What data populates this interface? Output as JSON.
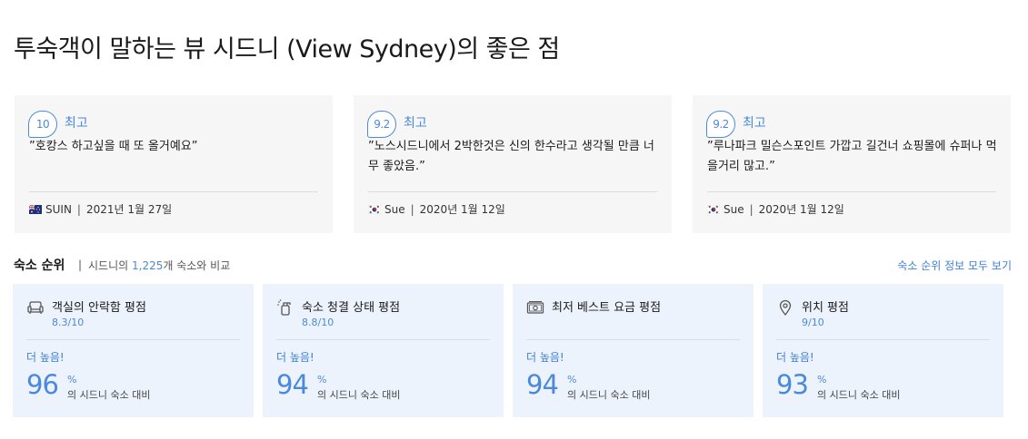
{
  "page": {
    "title": "투숙객이 말하는 뷰 시드니 (View Sydney)의 좋은 점"
  },
  "reviews": [
    {
      "score": "10",
      "score_word": "최고",
      "text": "”호캉스 하고싶을 때 또 올거예요”",
      "flag": "australia-flag-icon",
      "name": "SUIN",
      "date": "2021년 1월 27일"
    },
    {
      "score": "9.2",
      "score_word": "최고",
      "text": "”노스시드니에서 2박한것은 신의 한수라고 생각될 만큼 너무 좋았음.”",
      "flag": "south-korea-flag-icon",
      "name": "Sue",
      "date": "2020년 1월 12일"
    },
    {
      "score": "9.2",
      "score_word": "최고",
      "text": "”루나파크 밀슨스포인트 가깝고 길건너 쇼핑몰에 슈퍼나 먹을거리 많고.”",
      "flag": "south-korea-flag-icon",
      "name": "Sue",
      "date": "2020년 1월 12일"
    }
  ],
  "ranking": {
    "title": "숙소 순위",
    "separator": "|",
    "sub_prefix": "시드니의",
    "sub_count": "1,225",
    "sub_suffix": "개 숙소와 비교",
    "link": "숙소 순위 정보 모두 보기",
    "cards": [
      {
        "icon": "sofa-icon",
        "label": "객실의 안락함 평점",
        "score": "8.3/10",
        "higher": "더 높음!",
        "percent": "96",
        "percent_sign": "%",
        "compare": "의 시드니 숙소 대비"
      },
      {
        "icon": "cleaning-spray-icon",
        "label": "숙소 청결 상태 평점",
        "score": "8.8/10",
        "higher": "더 높음!",
        "percent": "94",
        "percent_sign": "%",
        "compare": "의 시드니 숙소 대비"
      },
      {
        "icon": "money-icon",
        "label": "최저 베스트 요금 평점",
        "score": "",
        "higher": "더 높음!",
        "percent": "94",
        "percent_sign": "%",
        "compare": "의 시드니 숙소 대비"
      },
      {
        "icon": "location-pin-icon",
        "label": "위치 평점",
        "score": "9/10",
        "higher": "더 높음!",
        "percent": "93",
        "percent_sign": "%",
        "compare": "의 시드니 숙소 대비"
      }
    ]
  },
  "colors": {
    "accent": "#4a89dc",
    "card_bg": "#f6f6f6",
    "rank_bg": "#edf3fd"
  }
}
